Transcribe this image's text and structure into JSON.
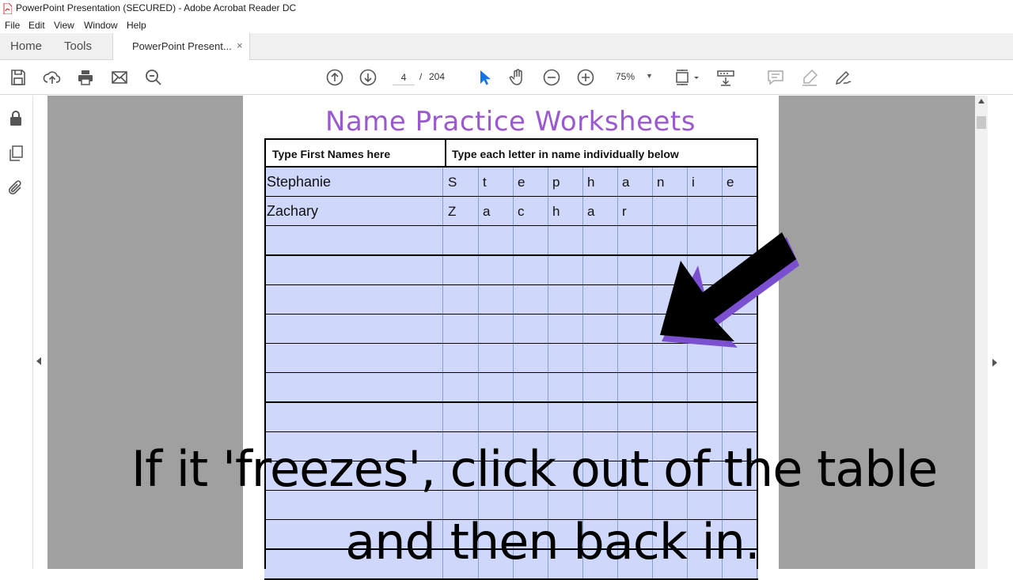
{
  "window": {
    "title": "PowerPoint Presentation (SECURED) - Adobe Acrobat Reader DC"
  },
  "menu": {
    "items": [
      "File",
      "Edit",
      "View",
      "Window",
      "Help"
    ]
  },
  "tabs": {
    "home": "Home",
    "tools": "Tools",
    "document": "PowerPoint Present...",
    "close": "×"
  },
  "toolbar": {
    "page_current": "4",
    "page_sep": "/",
    "page_total": "204",
    "zoom": "75%",
    "icons": [
      "save-icon",
      "upload-icon",
      "print-icon",
      "email-icon",
      "find-icon",
      "page-up-icon",
      "page-down-icon",
      "select-icon",
      "hand-icon",
      "zoom-out-icon",
      "zoom-in-icon",
      "fit-page-icon",
      "scroll-mode-icon",
      "comment-icon",
      "highlight-icon",
      "sign-icon"
    ]
  },
  "left_rail": {
    "icons": [
      "lock-icon",
      "pages-icon",
      "attachment-icon"
    ]
  },
  "document": {
    "title": "Name Practice Worksheets",
    "table": {
      "header_name": "Type First Names here",
      "header_letters": "Type each letter in name individually below",
      "rows": [
        {
          "name": "Stephanie",
          "letters": [
            "S",
            "t",
            "e",
            "p",
            "h",
            "a",
            "n",
            "i",
            "e"
          ]
        },
        {
          "name": "Zachary",
          "letters": [
            "Z",
            "a",
            "c",
            "h",
            "a",
            "r",
            "",
            "",
            ""
          ]
        }
      ],
      "empty_rows": 12
    }
  },
  "caption": {
    "line1": "If it 'freezes', click out of the table",
    "line2": "and then back in."
  },
  "colors": {
    "title_purple": "#9b59d0",
    "cell_fill": "#cfd8fb",
    "doc_background": "#a0a0a0",
    "select_tool_blue": "#1473e6"
  }
}
